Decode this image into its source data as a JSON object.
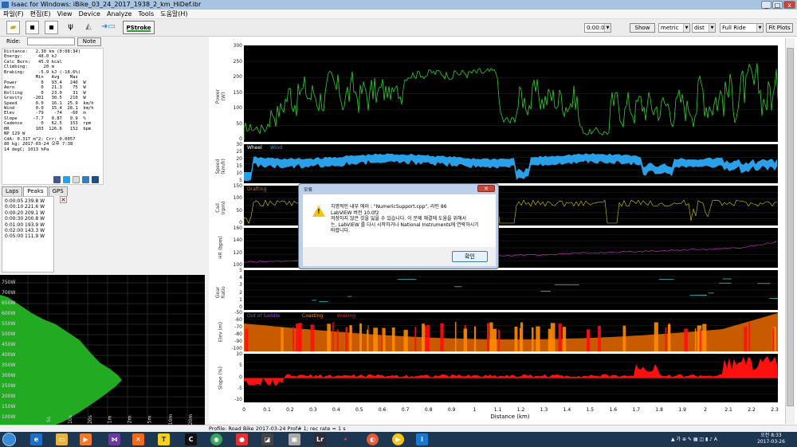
{
  "window": {
    "title": "Isaac for Windows: iBike_03_24_2017_1938_2_km_HiDef.ibr",
    "btn_min": "_",
    "btn_max": "□",
    "btn_close": "x"
  },
  "menu": [
    "파일(F)",
    "편집(E)",
    "View",
    "Device",
    "Analyze",
    "Tools",
    "도움말(H)"
  ],
  "toolbar": {
    "pstroke": "PStroke",
    "time_value": "0:00:05",
    "show": "Show",
    "units": "metric",
    "axis": "dist",
    "range": "Full Ride",
    "fit": "Fit Plots"
  },
  "ride": {
    "label": "Ride:",
    "note": "Note"
  },
  "stats_text": "Distance:   2.30 km (0:08:34)\nEnergy:      48.0 kJ\nCalc Burn:   45.9 kcal\nClimbing:      20 m\nBraking:     -5.9 kJ (-18.6%)\n            Min   Avg    Max\nPower         0   93.4   240  W\nAero          0   21.3    75  W\nRolling       0   23.0    31  W\nGravity    -201   30.5   210  W\nSpeed       0.0   16.1  25.9  km/h\nWind        0.0   15.4  28.1  km/h\nElev        -79    -74   -60  m\nSlope      -7.7   0.87   9.9  %\nCadence       0   62.5   153  rpm\nHR          103  126.6   152  bpm\nNP 129 W\nCdA: 0.317 m^2; Crr: 0.0057\n80 kg; 2017-03-24 오후 7:38\n14 degC; 1013 hPa",
  "tabs": [
    "Laps",
    "Peaks",
    "GPS"
  ],
  "peaks": [
    "0:00:05 239.8 W",
    "0:00:10 221.6 W",
    "0:00:20 209.1 W",
    "0:00:30 200.8 W",
    "0:01:00 193.9 W",
    "0:02:00 143.3 W",
    "0:05:00 111.9 W"
  ],
  "left_chart": {
    "y_ticks": [
      "750W",
      "700W",
      "650W",
      "600W",
      "550W",
      "500W",
      "450W",
      "400W",
      "350W",
      "300W",
      "250W",
      "200W",
      "150W",
      "100W",
      "50W"
    ],
    "x_ticks": [
      "5s",
      "10s",
      "20s",
      "1m",
      "2m",
      "5m",
      "10m",
      "20m"
    ],
    "color": "#22aa22"
  },
  "panels": [
    {
      "ylabel": "Power (W)",
      "ticks": [
        "300",
        "250",
        "200",
        "150",
        "100",
        "50",
        "0"
      ],
      "titles": []
    },
    {
      "ylabel": "Speed (km/h)",
      "ticks": [
        "30",
        "25",
        "20",
        "15",
        "10",
        "5"
      ],
      "titles": [
        "Wheel",
        "Wind"
      ]
    },
    {
      "ylabel": "Cad (rpm)",
      "ticks": [
        "150",
        "100",
        "50",
        "0"
      ],
      "titles": [
        "Drafting"
      ]
    },
    {
      "ylabel": "HR (bpm)",
      "ticks": [
        "160",
        "140",
        "120",
        "100"
      ],
      "titles": []
    },
    {
      "ylabel": "Gear Ratio",
      "ticks": [
        "5",
        "4",
        "3",
        "2",
        "1",
        "0"
      ],
      "titles": []
    },
    {
      "ylabel": "Elev (m)",
      "ticks": [
        "-50",
        "-60",
        "-70",
        "-80",
        "-90",
        "-100"
      ],
      "titles": [
        "Out of Saddle",
        "Coasting",
        "Braking"
      ]
    },
    {
      "ylabel": "Slope (%)",
      "ticks": [
        "10",
        "5",
        "0",
        "-5",
        "-10"
      ],
      "titles": []
    }
  ],
  "x_axis": {
    "label": "Distance (km)",
    "ticks": [
      "0",
      "0.1",
      "0.2",
      "0.3",
      "0.4",
      "0.5",
      "0.6",
      "0.7",
      "0.8",
      "0.9",
      "1",
      "1.1",
      "1.2",
      "1.3",
      "1.4",
      "1.5",
      "1.6",
      "1.7",
      "1.8",
      "1.9",
      "2",
      "2.1",
      "2.2",
      "2.3"
    ]
  },
  "status": "Profile: Road Bike 2017-03-24 Prof# 1; rec rate = 1 s",
  "dialog": {
    "title": "오류",
    "lines": [
      "치명적인 내부 에러 : \"NumericSupport.cpp\", 라인 86",
      "LabVIEW 버전 10.0f2",
      "저장하지 않은 것을 잃을 수 있습니다.  이 문제 해결에 도움을 위해서",
      "는, LabVIEW 를 다시 시작하거나 National Instruments에 연락하시기",
      "바랍니다."
    ],
    "ok": "확인"
  },
  "taskbar": {
    "time": "오전 8:33",
    "date": "2017-03-26"
  },
  "colors": {
    "power": "#2fcf2f",
    "speed": "#2aa0e8",
    "cadence": "#d8d000",
    "hr": "#c030c0",
    "elev": "#d06000",
    "slope": "#ff1010",
    "gear": "#30a0a0"
  }
}
